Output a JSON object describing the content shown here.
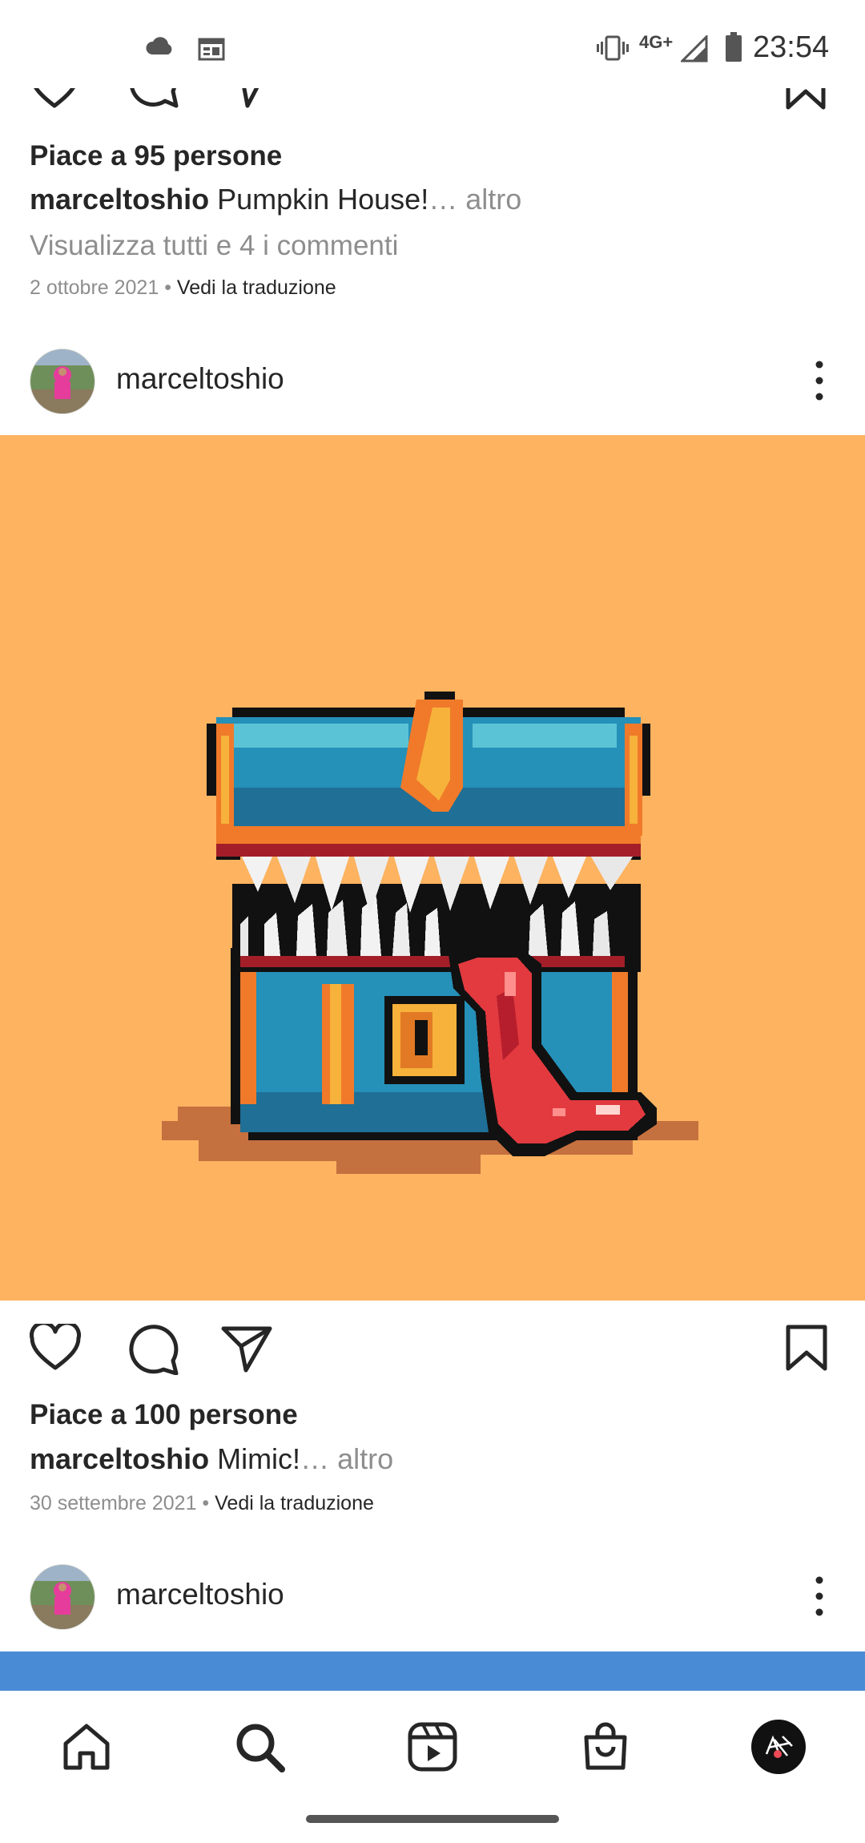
{
  "status_bar": {
    "time": "23:54",
    "network": "4G+",
    "icons": [
      "cloud-icon",
      "calendar-icon",
      "vibrate-icon",
      "signal-icon",
      "battery-icon"
    ]
  },
  "previous_post": {
    "likes": "Piace a 95 persone",
    "caption_user": "marceltoshio",
    "caption_text": " Pumpkin House!",
    "more": "… altro",
    "view_comments": "Visualizza tutti e 4 i commenti",
    "date": "2 ottobre 2021",
    "dot": " • ",
    "translate": "Vedi la traduzione"
  },
  "post": {
    "username": "marceltoshio",
    "image_subject": "pixel-art mimic treasure chest",
    "image_background": "#fdb360",
    "likes": "Piace a 100 persone",
    "caption_user": "marceltoshio",
    "caption_text": " Mimic!",
    "more": "… altro",
    "date": "30 settembre 2021",
    "dot": " • ",
    "translate": "Vedi la traduzione"
  },
  "next_post": {
    "username": "marceltoshio",
    "image_peek_color": "#4a8bd6"
  },
  "bottom_nav": {
    "items": [
      "home-icon",
      "search-icon",
      "reels-icon",
      "shop-icon",
      "profile-avatar"
    ]
  },
  "colors": {
    "text": "#262626",
    "muted": "#8e8e8e",
    "notification": "#ed4956"
  }
}
